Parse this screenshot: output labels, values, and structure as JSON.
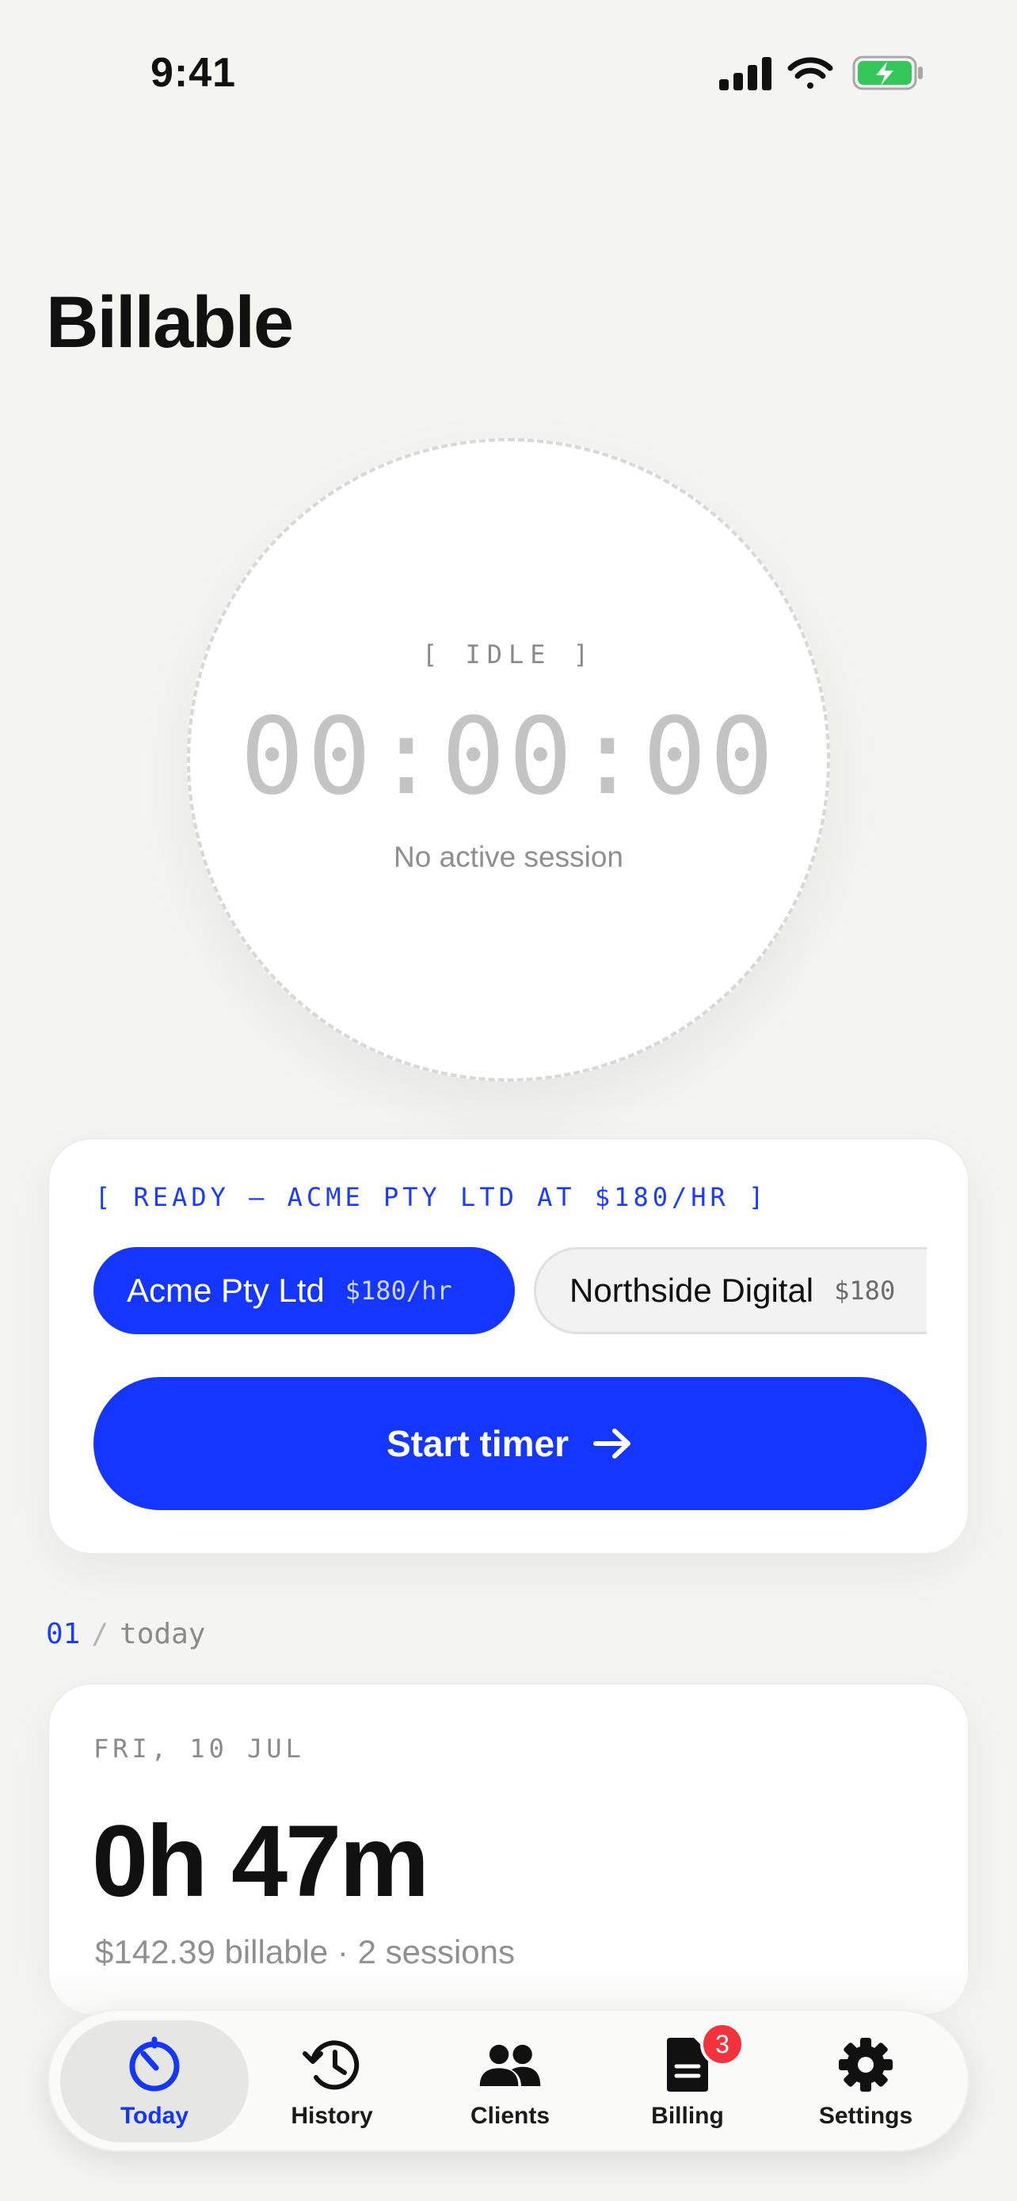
{
  "status_bar": {
    "time": "9:41"
  },
  "app": {
    "title": "Billable"
  },
  "timer": {
    "state": "[ IDLE ]",
    "time": "00:00:00",
    "subtitle": "No active session"
  },
  "ready_card": {
    "label": "[ READY — ACME PTY LTD AT $180/HR ]",
    "clients": [
      {
        "name": "Acme Pty Ltd",
        "rate": "$180/hr",
        "selected": true
      },
      {
        "name": "Northside Digital",
        "rate": "$180",
        "selected": false
      }
    ],
    "start_label": "Start timer"
  },
  "section": {
    "number": "01",
    "separator": "/",
    "name": "today"
  },
  "today": {
    "date": "FRI, 10 JUL",
    "total": "0h 47m",
    "summary": "$142.39 billable · 2 sessions"
  },
  "tabbar": {
    "tabs": [
      {
        "label": "Today",
        "icon": "timer-icon",
        "active": true
      },
      {
        "label": "History",
        "icon": "history-icon"
      },
      {
        "label": "Clients",
        "icon": "people-icon"
      },
      {
        "label": "Billing",
        "icon": "document-icon",
        "badge": "3"
      },
      {
        "label": "Settings",
        "icon": "gear-icon"
      }
    ]
  },
  "colors": {
    "accent": "#1536ff",
    "badge": "#f2323c",
    "battery": "#34c759"
  }
}
